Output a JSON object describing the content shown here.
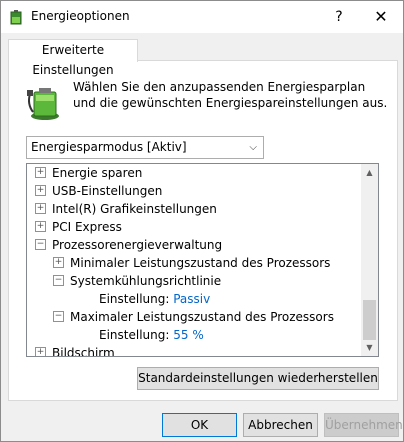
{
  "window": {
    "title": "Energieoptionen",
    "help": "?",
    "close": "✕"
  },
  "tab": {
    "label": "Erweiterte Einstellungen"
  },
  "description": "Wählen Sie den anzupassenden Energiesparplan und die gewünschten Energiespareinstellungen aus.",
  "plan_select": {
    "value": "Energiesparmodus [Aktiv]",
    "arrow": "⌵"
  },
  "tree": {
    "items": [
      {
        "label": "Energie sparen",
        "expander": "+"
      },
      {
        "label": "USB-Einstellungen",
        "expander": "+"
      },
      {
        "label": "Intel(R) Grafikeinstellungen",
        "expander": "+"
      },
      {
        "label": "PCI Express",
        "expander": "+"
      },
      {
        "label": "Prozessorenergieverwaltung",
        "expander": "−"
      },
      {
        "label": "Minimaler Leistungszustand des Prozessors",
        "expander": "+"
      },
      {
        "label": "Systemkühlungsrichtlinie",
        "expander": "−"
      },
      {
        "label": "Einstellung:",
        "value": "Passiv"
      },
      {
        "label": "Maximaler Leistungszustand des Prozessors",
        "expander": "−"
      },
      {
        "label": "Einstellung:",
        "value": "55 %"
      },
      {
        "label": "Bildschirm",
        "expander": "+"
      }
    ],
    "scroll_up": "▲",
    "scroll_down": "▼"
  },
  "buttons": {
    "restore": "Standardeinstellungen wiederherstellen",
    "ok": "OK",
    "cancel": "Abbrechen",
    "apply": "Übernehmen"
  }
}
